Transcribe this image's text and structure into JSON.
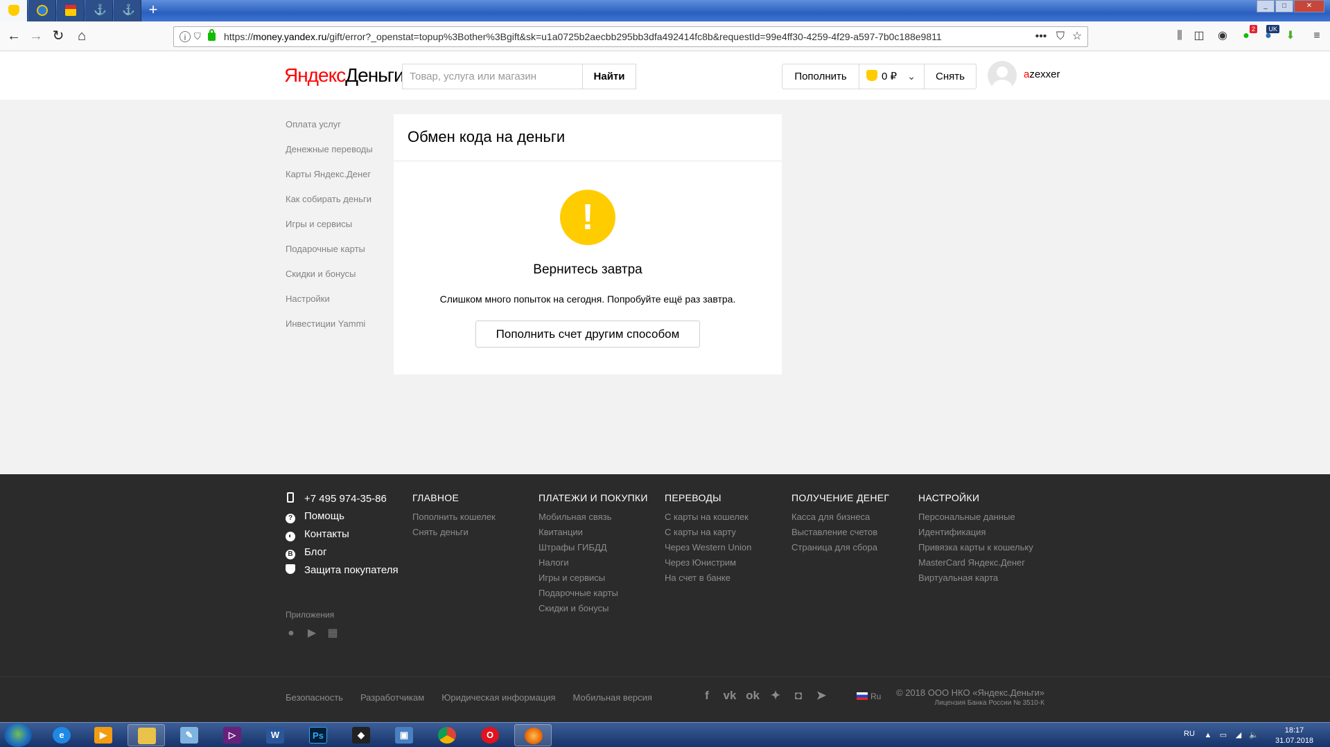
{
  "browser": {
    "url_prefix": "https://",
    "url_host": "money.yandex.ru",
    "url_path": "/gift/error?_openstat=topup%3Bother%3Bgift&sk=u1a0725b2aecbb295bb3dfa492414fc8b&requestId=99e4ff30-4259-4f29-a597-7b0c188e9811",
    "badge_count": "2",
    "badge_uk": "UK"
  },
  "header": {
    "logo_part1": "Яндекс",
    "logo_part2": "Деньги",
    "search_placeholder": "Товар, услуга или магазин",
    "search_button": "Найти",
    "topup_button": "Пополнить",
    "balance": "0 ₽",
    "withdraw_button": "Снять",
    "username_first": "a",
    "username_rest": "zexxer"
  },
  "sidebar": {
    "items": [
      {
        "label": "Оплата услуг"
      },
      {
        "label": "Денежные переводы"
      },
      {
        "label": "Карты Яндекс.Денег"
      },
      {
        "label": "Как собирать деньги"
      },
      {
        "label": "Игры и сервисы"
      },
      {
        "label": "Подарочные карты"
      },
      {
        "label": "Скидки и бонусы"
      },
      {
        "label": "Настройки"
      },
      {
        "label": "Инвестиции Yammi"
      }
    ]
  },
  "card": {
    "title": "Обмен кода на деньги",
    "warning_glyph": "!",
    "error_title": "Вернитесь завтра",
    "error_text": "Слишком много попыток на сегодня. Попробуйте ещё раз завтра.",
    "alt_button": "Пополнить счет другим способом"
  },
  "footer": {
    "contacts": [
      {
        "label": "+7 495 974-35-86"
      },
      {
        "label": "Помощь"
      },
      {
        "label": "Контакты"
      },
      {
        "label": "Блог"
      },
      {
        "label": "Защита покупателя"
      }
    ],
    "columns": [
      {
        "heading": "ГЛАВНОЕ",
        "links": [
          "Пополнить кошелек",
          "Снять деньги"
        ]
      },
      {
        "heading": "ПЛАТЕЖИ И ПОКУПКИ",
        "links": [
          "Мобильная связь",
          "Квитанции",
          "Штрафы ГИБДД",
          "Налоги",
          "Игры и сервисы",
          "Подарочные карты",
          "Скидки и бонусы"
        ]
      },
      {
        "heading": "ПЕРЕВОДЫ",
        "links": [
          "С карты на кошелек",
          "С карты на карту",
          "Через Western Union",
          "Через Юнистрим",
          "На счет в банке"
        ]
      },
      {
        "heading": "ПОЛУЧЕНИЕ ДЕНЕГ",
        "links": [
          "Касса для бизнеса",
          "Выставление счетов",
          "Страница для сбора"
        ]
      },
      {
        "heading": "НАСТРОЙКИ",
        "links": [
          "Персональные данные",
          "Идентификация",
          "Привязка карты к кошельку",
          "MasterCard Яндекс.Денег",
          "Виртуальная карта"
        ]
      }
    ],
    "apps_label": "Приложения",
    "bottom_links": [
      "Безопасность",
      "Разработчикам",
      "Юридическая информация",
      "Мобильная версия"
    ],
    "language": "Ru",
    "copyright": "© 2018 ООО НКО «Яндекс.Деньги»",
    "license": "Лицензия Банка России № 3510-К"
  },
  "taskbar": {
    "lang": "RU",
    "time": "18:17",
    "date": "31.07.2018"
  }
}
